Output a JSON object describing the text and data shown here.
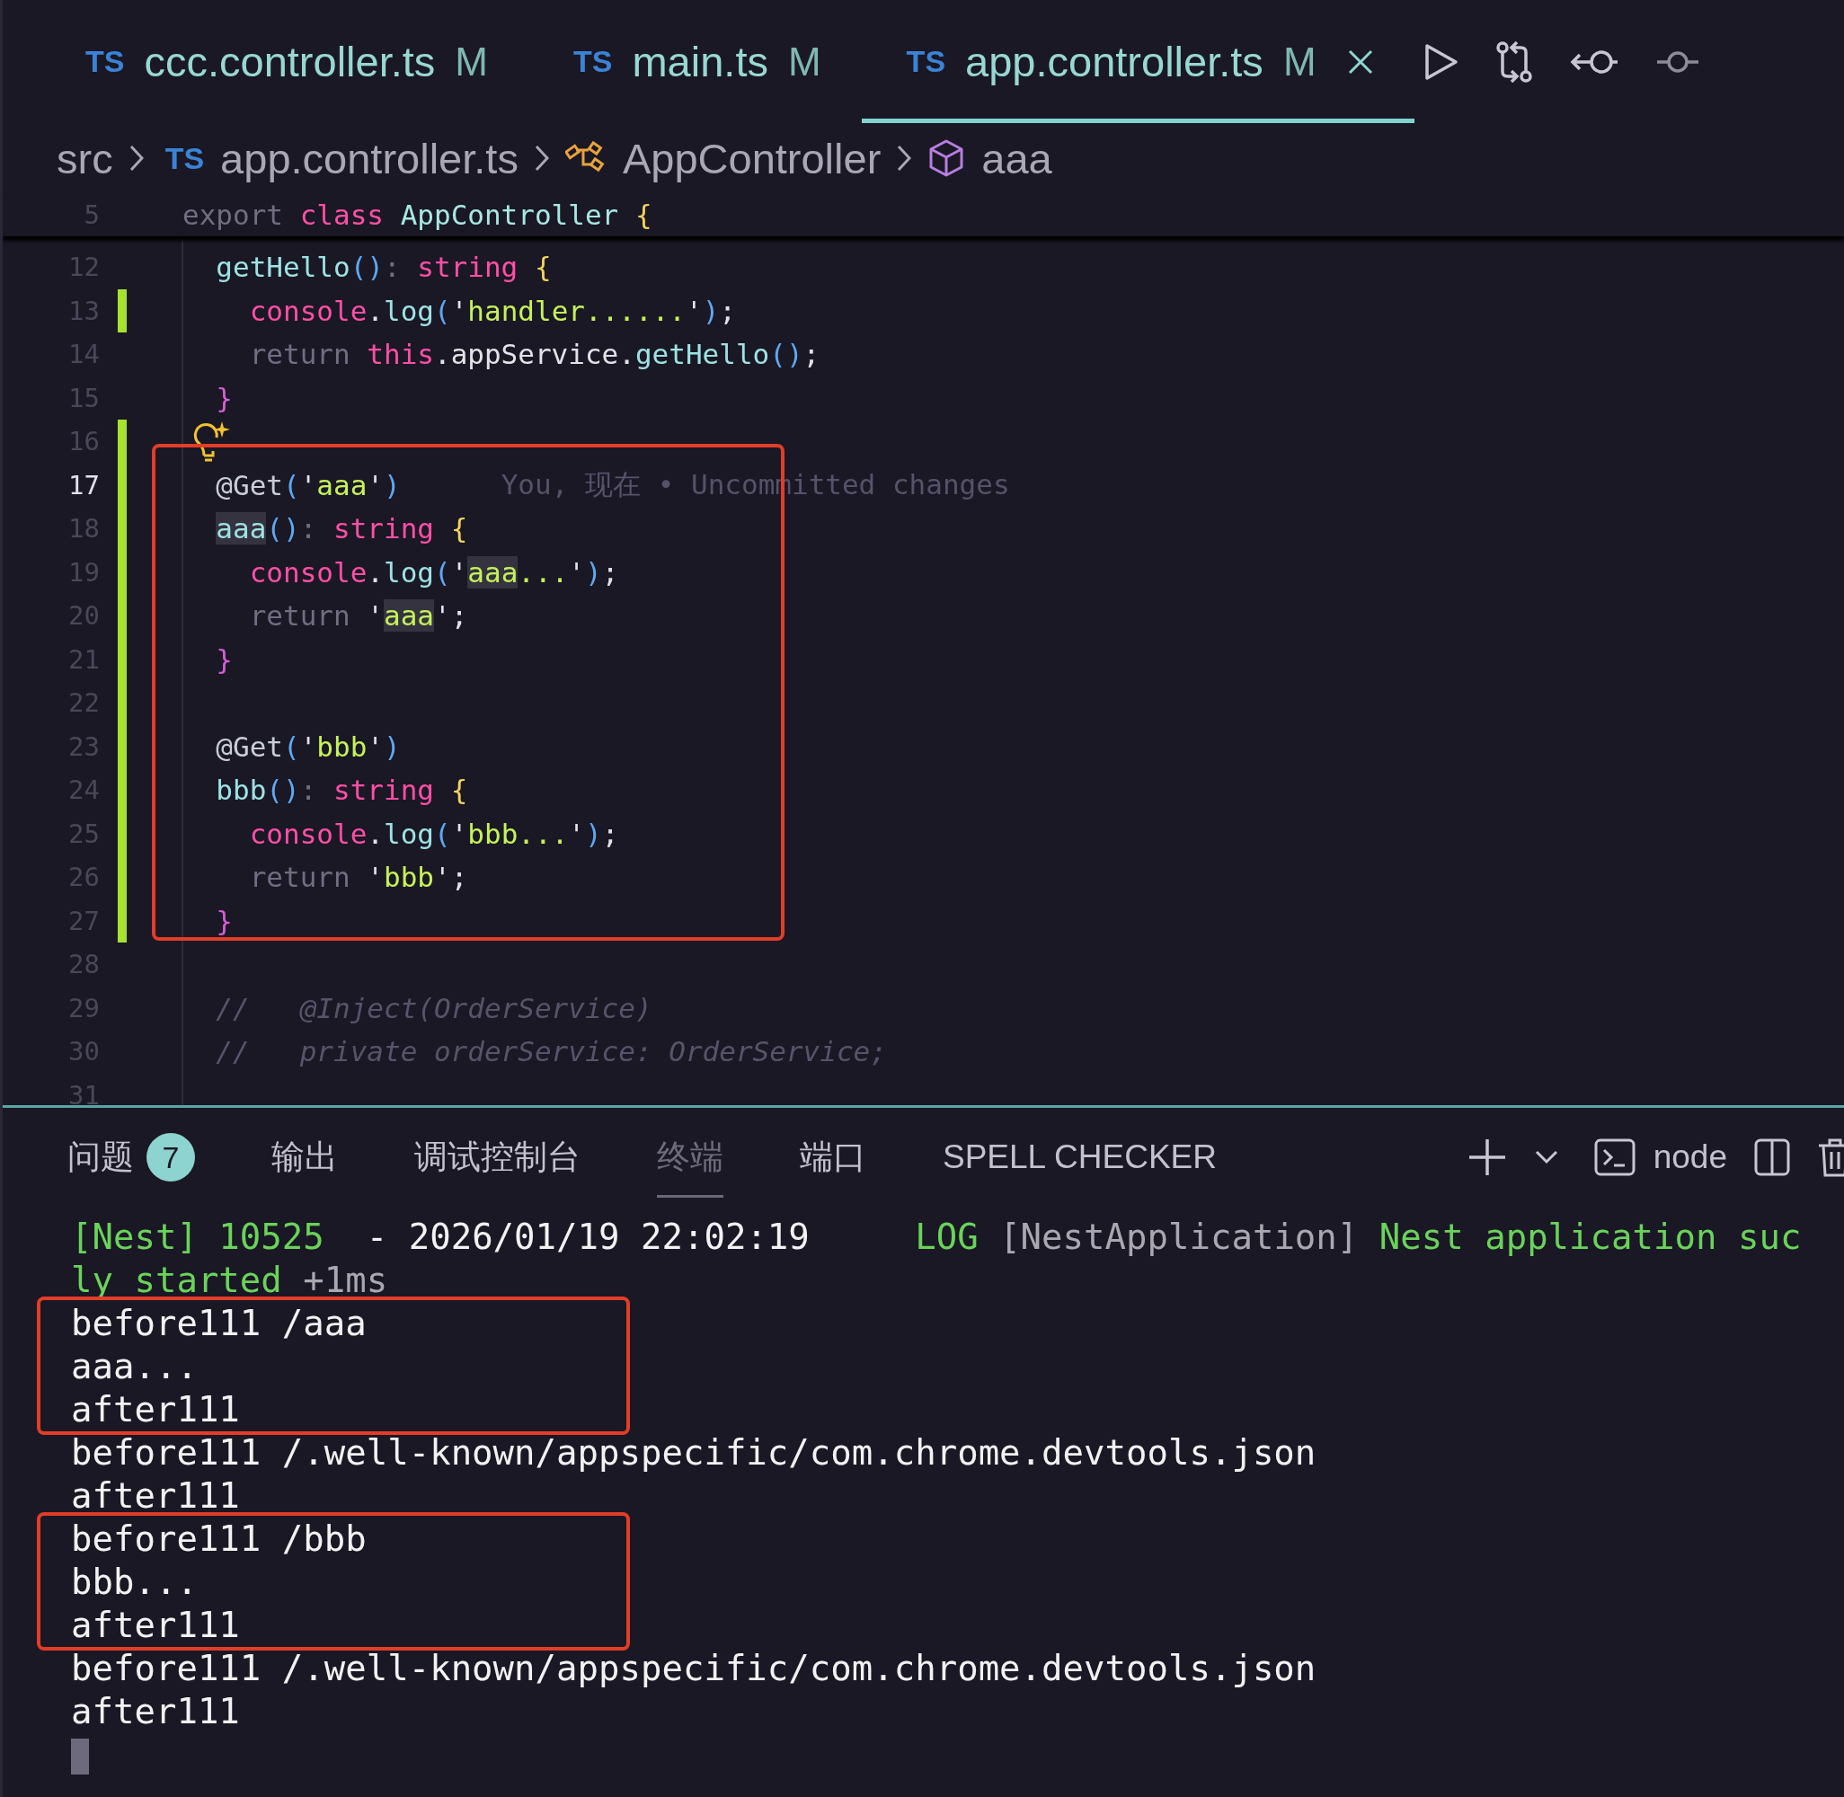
{
  "tabs": [
    {
      "badge": "TS",
      "name": "ccc.controller.ts",
      "status": "M",
      "selected": false
    },
    {
      "badge": "TS",
      "name": "main.ts",
      "status": "M",
      "selected": false
    },
    {
      "badge": "TS",
      "name": "app.controller.ts",
      "status": "M",
      "selected": true
    }
  ],
  "breadcrumb": [
    {
      "kind": "folder",
      "label": "src"
    },
    {
      "kind": "file",
      "badge": "TS",
      "label": "app.controller.ts"
    },
    {
      "kind": "class",
      "label": "AppController"
    },
    {
      "kind": "method",
      "label": "aaa"
    }
  ],
  "sticky_line": {
    "number": "5",
    "tokens": [
      {
        "text": "export ",
        "kind": "muted"
      },
      {
        "text": "class ",
        "kind": "keyword"
      },
      {
        "text": "AppController ",
        "kind": "type"
      },
      {
        "text": "{",
        "kind": "brace"
      }
    ]
  },
  "code_blocks": [
    {
      "boxed": false,
      "lines": [
        {
          "number": "12",
          "changed": false,
          "current": false,
          "tokens": [
            {
              "text": "  getHello",
              "kind": "fn"
            },
            {
              "text": "()",
              "kind": "paren"
            },
            {
              "text": ": ",
              "kind": "muted"
            },
            {
              "text": "string",
              "kind": "keyword"
            },
            {
              "text": " {",
              "kind": "brace"
            }
          ]
        },
        {
          "number": "13",
          "changed": true,
          "current": false,
          "tokens": [
            {
              "text": "    console",
              "kind": "keyword"
            },
            {
              "text": ".",
              "kind": "plain"
            },
            {
              "text": "log",
              "kind": "fn"
            },
            {
              "text": "(",
              "kind": "paren"
            },
            {
              "text": "'",
              "kind": "plain"
            },
            {
              "text": "handler......",
              "kind": "string"
            },
            {
              "text": "'",
              "kind": "plain"
            },
            {
              "text": ")",
              "kind": "paren"
            },
            {
              "text": ";",
              "kind": "plain"
            }
          ]
        },
        {
          "number": "14",
          "changed": false,
          "current": false,
          "tokens": [
            {
              "text": "    return ",
              "kind": "muted"
            },
            {
              "text": "this",
              "kind": "keyword"
            },
            {
              "text": ".appService.",
              "kind": "plain"
            },
            {
              "text": "getHello",
              "kind": "fn"
            },
            {
              "text": "()",
              "kind": "paren"
            },
            {
              "text": ";",
              "kind": "plain"
            }
          ]
        },
        {
          "number": "15",
          "changed": false,
          "current": false,
          "tokens": [
            {
              "text": "  }",
              "kind": "brace2"
            }
          ]
        },
        {
          "number": "16",
          "changed": true,
          "current": false,
          "lightbulb": true
        }
      ]
    },
    {
      "boxed": true,
      "lines": [
        {
          "number": "17",
          "changed": true,
          "current": true,
          "blame": "You, 现在 • Uncommitted changes",
          "tokens": [
            {
              "text": "  @Get",
              "kind": "deco"
            },
            {
              "text": "(",
              "kind": "paren"
            },
            {
              "text": "'",
              "kind": "plain"
            },
            {
              "text": "aaa",
              "kind": "string"
            },
            {
              "text": "'",
              "kind": "plain"
            },
            {
              "text": ")",
              "kind": "paren"
            }
          ]
        },
        {
          "number": "18",
          "changed": true,
          "current": false,
          "tokens": [
            {
              "text": "  aaa",
              "kind": "fn",
              "highlight": true
            },
            {
              "text": "()",
              "kind": "paren"
            },
            {
              "text": ": ",
              "kind": "muted"
            },
            {
              "text": "string",
              "kind": "keyword"
            },
            {
              "text": " {",
              "kind": "brace"
            }
          ]
        },
        {
          "number": "19",
          "changed": true,
          "current": false,
          "tokens": [
            {
              "text": "    console",
              "kind": "keyword"
            },
            {
              "text": ".",
              "kind": "plain"
            },
            {
              "text": "log",
              "kind": "fn"
            },
            {
              "text": "(",
              "kind": "paren"
            },
            {
              "text": "'",
              "kind": "plain"
            },
            {
              "text": "aaa",
              "kind": "string",
              "highlight": true
            },
            {
              "text": "...",
              "kind": "string"
            },
            {
              "text": "'",
              "kind": "plain"
            },
            {
              "text": ")",
              "kind": "paren"
            },
            {
              "text": ";",
              "kind": "plain"
            }
          ]
        },
        {
          "number": "20",
          "changed": true,
          "current": false,
          "tokens": [
            {
              "text": "    return ",
              "kind": "muted"
            },
            {
              "text": "'",
              "kind": "plain"
            },
            {
              "text": "aaa",
              "kind": "string",
              "highlight": true
            },
            {
              "text": "'",
              "kind": "plain"
            },
            {
              "text": ";",
              "kind": "plain"
            }
          ]
        },
        {
          "number": "21",
          "changed": true,
          "current": false,
          "tokens": [
            {
              "text": "  }",
              "kind": "brace2"
            }
          ]
        },
        {
          "number": "22",
          "changed": true,
          "current": false
        },
        {
          "number": "23",
          "changed": true,
          "current": false,
          "tokens": [
            {
              "text": "  @Get",
              "kind": "deco"
            },
            {
              "text": "(",
              "kind": "paren"
            },
            {
              "text": "'",
              "kind": "plain"
            },
            {
              "text": "bbb",
              "kind": "string"
            },
            {
              "text": "'",
              "kind": "plain"
            },
            {
              "text": ")",
              "kind": "paren"
            }
          ]
        },
        {
          "number": "24",
          "changed": true,
          "current": false,
          "tokens": [
            {
              "text": "  bbb",
              "kind": "fn"
            },
            {
              "text": "()",
              "kind": "paren"
            },
            {
              "text": ": ",
              "kind": "muted"
            },
            {
              "text": "string",
              "kind": "keyword"
            },
            {
              "text": " {",
              "kind": "brace"
            }
          ]
        },
        {
          "number": "25",
          "changed": true,
          "current": false,
          "tokens": [
            {
              "text": "    console",
              "kind": "keyword"
            },
            {
              "text": ".",
              "kind": "plain"
            },
            {
              "text": "log",
              "kind": "fn"
            },
            {
              "text": "(",
              "kind": "paren"
            },
            {
              "text": "'",
              "kind": "plain"
            },
            {
              "text": "bbb...",
              "kind": "string"
            },
            {
              "text": "'",
              "kind": "plain"
            },
            {
              "text": ")",
              "kind": "paren"
            },
            {
              "text": ";",
              "kind": "plain"
            }
          ]
        },
        {
          "number": "26",
          "changed": true,
          "current": false,
          "tokens": [
            {
              "text": "    return ",
              "kind": "muted"
            },
            {
              "text": "'",
              "kind": "plain"
            },
            {
              "text": "bbb",
              "kind": "string"
            },
            {
              "text": "'",
              "kind": "plain"
            },
            {
              "text": ";",
              "kind": "plain"
            }
          ]
        },
        {
          "number": "27",
          "changed": true,
          "current": false,
          "tokens": [
            {
              "text": "  }",
              "kind": "brace2"
            }
          ]
        }
      ]
    },
    {
      "boxed": false,
      "lines": [
        {
          "number": "28",
          "changed": false,
          "current": false
        },
        {
          "number": "29",
          "changed": false,
          "current": false,
          "tokens": [
            {
              "text": "  //   @Inject(OrderService)",
              "kind": "comment"
            }
          ]
        },
        {
          "number": "30",
          "changed": false,
          "current": false,
          "tokens": [
            {
              "text": "  //   private orderService: OrderService;",
              "kind": "comment"
            }
          ]
        },
        {
          "number": "31",
          "changed": false,
          "current": false
        }
      ]
    }
  ],
  "panel": {
    "tabs": [
      {
        "label": "问题",
        "badge": "7",
        "selected": false
      },
      {
        "label": "输出",
        "selected": false
      },
      {
        "label": "调试控制台",
        "selected": false
      },
      {
        "label": "终端",
        "selected": true
      },
      {
        "label": "端口",
        "selected": false
      },
      {
        "label": "SPELL CHECKER",
        "selected": false
      }
    ],
    "terminal_name": "node"
  },
  "terminal": {
    "cursor_visible": true,
    "blocks": [
      {
        "boxed": false,
        "lines": [
          {
            "segments": [
              {
                "text": "[Nest] 10525  ",
                "kind": "green"
              },
              {
                "text": "- 2026/01/19 22:02:19     ",
                "kind": "plain"
              },
              {
                "text": "LOG ",
                "kind": "green"
              },
              {
                "text": "[NestApplication] ",
                "kind": "dim"
              },
              {
                "text": "Nest application suc",
                "kind": "green"
              }
            ]
          },
          {
            "segments": [
              {
                "text": "ly started ",
                "kind": "green"
              },
              {
                "text": "+1ms",
                "kind": "dim"
              }
            ]
          }
        ]
      },
      {
        "boxed": true,
        "lines": [
          {
            "segments": [
              {
                "text": "before111 /aaa",
                "kind": "plain"
              }
            ]
          },
          {
            "segments": [
              {
                "text": "aaa...",
                "kind": "plain"
              }
            ]
          },
          {
            "segments": [
              {
                "text": "after111",
                "kind": "plain"
              }
            ]
          }
        ]
      },
      {
        "boxed": false,
        "lines": [
          {
            "segments": [
              {
                "text": "before111 /.well-known/appspecific/com.chrome.devtools.json",
                "kind": "plain"
              }
            ]
          },
          {
            "segments": [
              {
                "text": "after111",
                "kind": "plain"
              }
            ]
          }
        ]
      },
      {
        "boxed": true,
        "lines": [
          {
            "segments": [
              {
                "text": "before111 /bbb",
                "kind": "plain"
              }
            ]
          },
          {
            "segments": [
              {
                "text": "bbb...",
                "kind": "plain"
              }
            ]
          },
          {
            "segments": [
              {
                "text": "after111",
                "kind": "plain"
              }
            ]
          }
        ]
      },
      {
        "boxed": false,
        "lines": [
          {
            "segments": [
              {
                "text": "before111 /.well-known/appspecific/com.chrome.devtools.json",
                "kind": "plain"
              }
            ]
          },
          {
            "segments": [
              {
                "text": "after111",
                "kind": "plain"
              }
            ]
          }
        ]
      }
    ]
  }
}
